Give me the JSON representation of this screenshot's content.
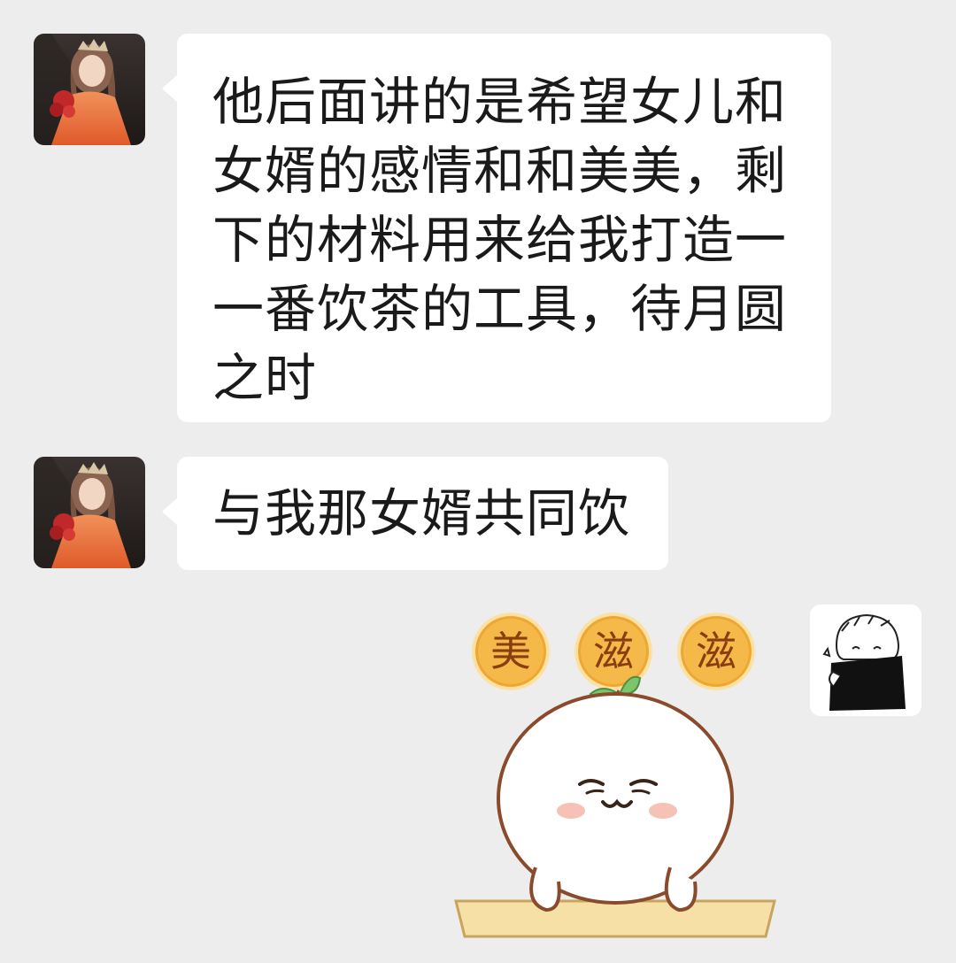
{
  "messages": [
    {
      "sender": "other",
      "avatar": "anime-girl-orange-dress-avatar",
      "lines": [
        "他后面讲的是希望女儿和",
        "女婿的感情和和美美，剩",
        "下的材料用来给我打造一",
        "一番饮茶的工具，待月圆",
        "之时"
      ]
    },
    {
      "sender": "other",
      "avatar": "anime-girl-orange-dress-avatar",
      "text": "与我那女婿共同饮"
    },
    {
      "sender": "self",
      "avatar": "sketch-character-black-coat-avatar",
      "sticker": {
        "name": "round-mascot-with-sprout-sticker",
        "badges": [
          "美",
          "滋",
          "滋"
        ],
        "colors": {
          "badge": "#f5b94a",
          "sprout": "#7cc56b",
          "blush": "#f7c2b6"
        }
      }
    }
  ],
  "colors": {
    "background": "#ededed",
    "bubble": "#ffffff",
    "text": "#1a1a1a"
  }
}
